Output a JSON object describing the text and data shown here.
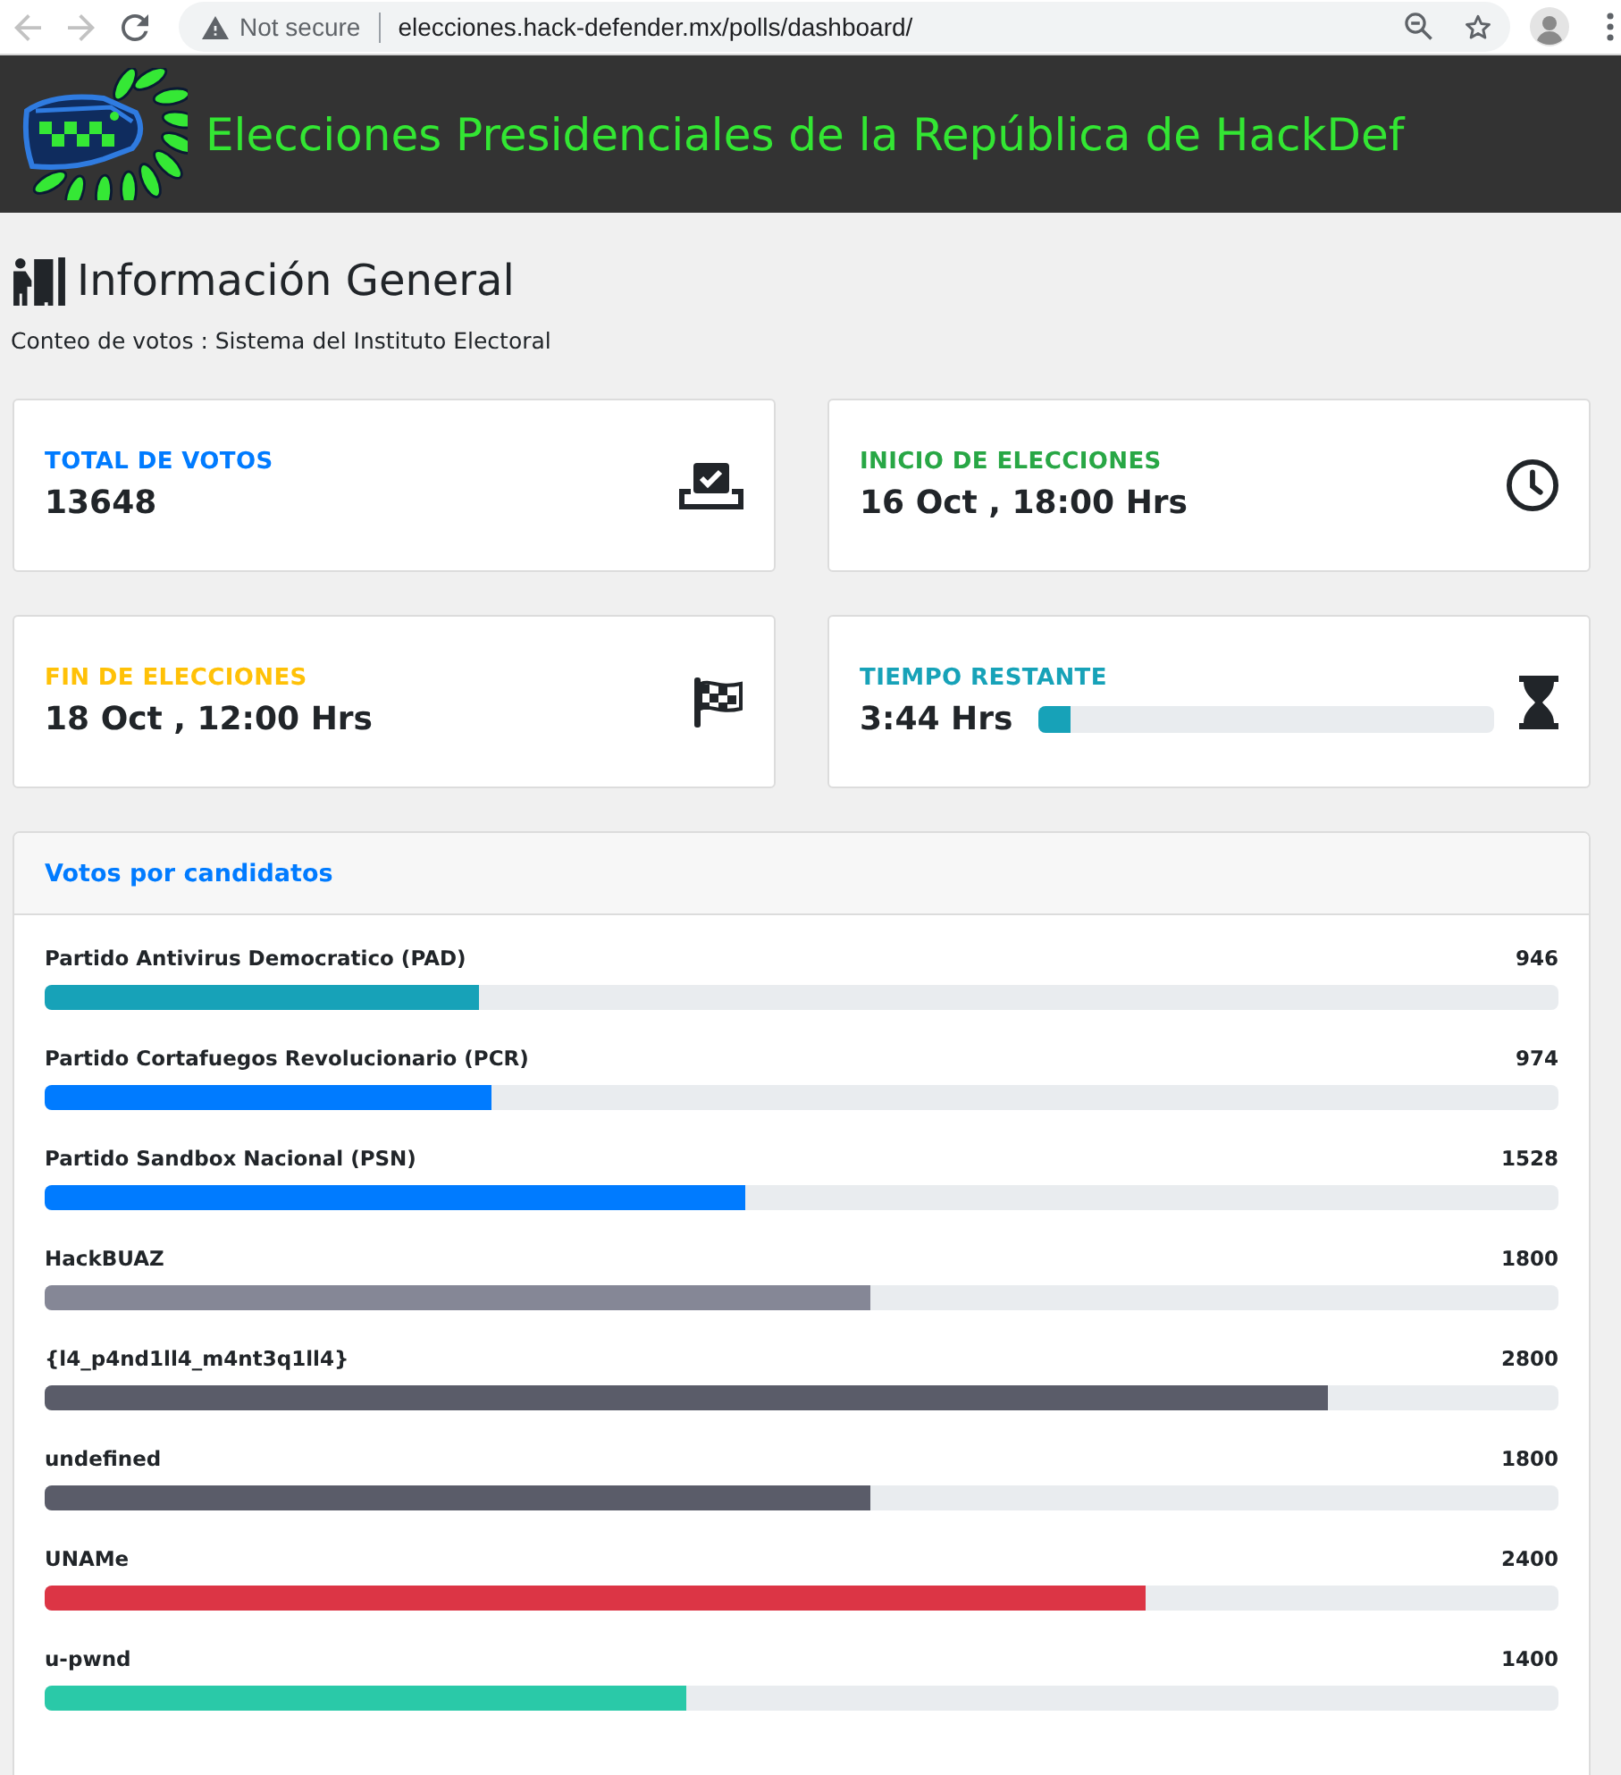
{
  "browser": {
    "nav_buttons": [
      {
        "kind": "back",
        "disabled": true
      },
      {
        "kind": "forward",
        "disabled": true
      },
      {
        "kind": "reload",
        "disabled": false
      }
    ],
    "security_label": "Not secure",
    "url": "elecciones.hack-defender.mx/polls/dashboard/"
  },
  "header": {
    "title": "Elecciones Presidenciales de la República de HackDef"
  },
  "section": {
    "title": "Información General",
    "subtitle": "Conteo de votos : Sistema del Instituto Electoral"
  },
  "cards": [
    {
      "kind": "stat",
      "label": "TOTAL DE VOTOS",
      "color": "#007bff",
      "value": "13648"
    },
    {
      "kind": "stat",
      "label": "INICIO DE ELECCIONES",
      "color": "#28a745",
      "value": "16 Oct , 18:00 Hrs"
    },
    {
      "kind": "stat",
      "label": "FIN DE ELECCIONES",
      "color": "#ffc107",
      "value": "18 Oct , 12:00 Hrs"
    },
    {
      "kind": "progress",
      "label": "TIEMPO RESTANTE",
      "color": "#17a2b8",
      "value": "3:44 Hrs",
      "level": 0.07
    }
  ],
  "candidates": {
    "title": "Votos por candidatos",
    "items": [
      {
        "name": "Partido Antivirus Democratico (PAD)",
        "votes": "946",
        "level": 0.287,
        "color": "#17a2b8"
      },
      {
        "name": "Partido Cortafuegos Revolucionario (PCR)",
        "votes": "974",
        "level": 0.295,
        "color": "#007bff"
      },
      {
        "name": "Partido Sandbox Nacional (PSN)",
        "votes": "1528",
        "level": 0.463,
        "color": "#007bff"
      },
      {
        "name": "HackBUAZ",
        "votes": "1800",
        "level": 0.545,
        "color": "#858796"
      },
      {
        "name": "{l4_p4nd1ll4_m4nt3q1ll4}",
        "votes": "2800",
        "level": 0.848,
        "color": "#5a5c69"
      },
      {
        "name": "undefined",
        "votes": "1800",
        "level": 0.545,
        "color": "#5a5c69"
      },
      {
        "name": "UNAMe",
        "votes": "2400",
        "level": 0.727,
        "color": "#dc3545"
      },
      {
        "name": "u-pwnd",
        "votes": "1400",
        "level": 0.424,
        "color": "#2ac9a8"
      }
    ]
  }
}
